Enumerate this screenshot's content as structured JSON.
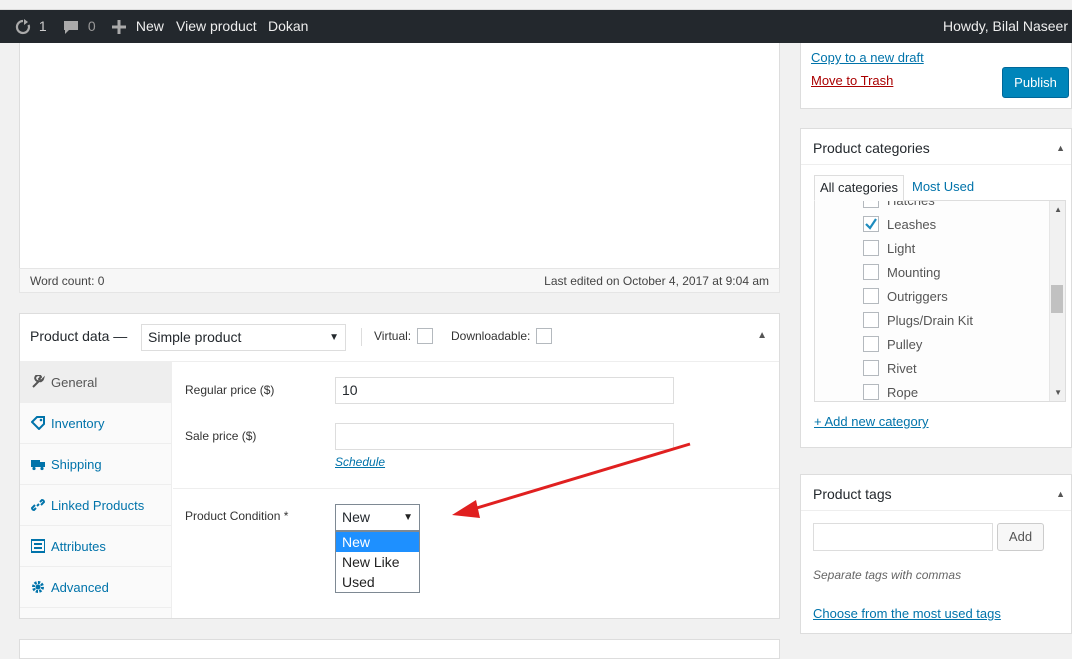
{
  "adminbar": {
    "updates_count": "1",
    "comments_count": "0",
    "new_label": "New",
    "view_product_label": "View product",
    "dokan_label": "Dokan",
    "howdy": "Howdy, Bilal Naseer"
  },
  "editor": {
    "word_count": "Word count: 0",
    "last_edited": "Last edited on October 4, 2017 at 9:04 am"
  },
  "product_data": {
    "title": "Product data —",
    "product_type": "Simple product",
    "virtual_label": "Virtual:",
    "downloadable_label": "Downloadable:",
    "tabs": [
      {
        "label": "General"
      },
      {
        "label": "Inventory"
      },
      {
        "label": "Shipping"
      },
      {
        "label": "Linked Products"
      },
      {
        "label": "Attributes"
      },
      {
        "label": "Advanced"
      }
    ],
    "regular_price_label": "Regular price ($)",
    "regular_price_value": "10",
    "sale_price_label": "Sale price ($)",
    "sale_price_value": "",
    "schedule_label": "Schedule",
    "condition_label": "Product Condition *",
    "condition_selected": "New",
    "condition_options": [
      "New",
      "New Like",
      "Used"
    ]
  },
  "publish": {
    "copy_draft": "Copy to a new draft",
    "move_trash": "Move to Trash",
    "publish_label": "Publish"
  },
  "categories": {
    "title": "Product categories",
    "tab_all": "All categories",
    "tab_most_used": "Most Used",
    "items": [
      {
        "label": "Hatches",
        "checked": false
      },
      {
        "label": "Leashes",
        "checked": true
      },
      {
        "label": "Light",
        "checked": false
      },
      {
        "label": "Mounting",
        "checked": false
      },
      {
        "label": "Outriggers",
        "checked": false
      },
      {
        "label": "Plugs/Drain Kit",
        "checked": false
      },
      {
        "label": "Pulley",
        "checked": false
      },
      {
        "label": "Rivet",
        "checked": false
      },
      {
        "label": "Rope",
        "checked": false
      }
    ],
    "add_new": "+ Add new category"
  },
  "tags": {
    "title": "Product tags",
    "input_value": "",
    "add_label": "Add",
    "hint": "Separate tags with commas",
    "choose_link": "Choose from the most used tags"
  },
  "colors": {
    "adminbar_bg": "#23282d",
    "link": "#0073aa",
    "publish_button": "#0085ba",
    "trash_link": "#a00",
    "dropdown_highlight": "#1e90ff",
    "annotation_arrow": "#e02020"
  }
}
